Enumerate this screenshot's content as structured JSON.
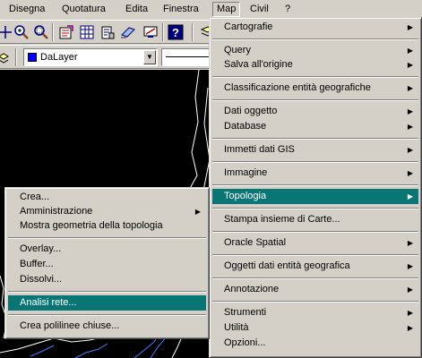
{
  "menubar": {
    "items": [
      {
        "label": "Disegna"
      },
      {
        "label": "Quotatura"
      },
      {
        "label": "Edita"
      },
      {
        "label": "Finestra"
      },
      {
        "label": "Map"
      },
      {
        "label": "Civil"
      },
      {
        "label": "?"
      }
    ],
    "active": "Map"
  },
  "toolbar": {
    "layer_combo_value": "DaLayer",
    "layer_swatch_color": "#0000ff"
  },
  "map_menu": {
    "items": [
      {
        "label": "Cartografie",
        "submenu": true
      },
      {
        "label": "Query",
        "submenu": true
      },
      {
        "label": "Salva all'origine",
        "submenu": true
      },
      {
        "label": "Classificazione entità geografiche",
        "submenu": true
      },
      {
        "label": "Dati oggetto",
        "submenu": true
      },
      {
        "label": "Database",
        "submenu": true
      },
      {
        "label": "Immetti dati GIS",
        "submenu": true
      },
      {
        "label": "Immagine",
        "submenu": true
      },
      {
        "label": "Topologia",
        "submenu": true,
        "highlighted": true
      },
      {
        "label": "Stampa insieme di Carte...",
        "submenu": false
      },
      {
        "label": "Oracle Spatial",
        "submenu": true
      },
      {
        "label": "Oggetti dati entità geografica",
        "submenu": true
      },
      {
        "label": "Annotazione",
        "submenu": true
      },
      {
        "label": "Strumenti",
        "submenu": true
      },
      {
        "label": "Utilità",
        "submenu": true
      },
      {
        "label": "Opzioni...",
        "submenu": false
      }
    ]
  },
  "topology_menu": {
    "items": [
      {
        "label": "Crea...",
        "submenu": false
      },
      {
        "label": "Amministrazione",
        "submenu": true
      },
      {
        "label": "Mostra geometria della topologia",
        "submenu": false
      },
      {
        "label": "Overlay...",
        "submenu": false
      },
      {
        "label": "Buffer...",
        "submenu": false
      },
      {
        "label": "Dissolvi...",
        "submenu": false
      },
      {
        "label": "Analisi rete...",
        "submenu": false,
        "highlighted": true
      },
      {
        "label": "Crea polilinee chiuse...",
        "submenu": false
      }
    ]
  },
  "colors": {
    "highlight": "#0a7575",
    "face": "#d4d0c8",
    "canvas": "#000000"
  }
}
